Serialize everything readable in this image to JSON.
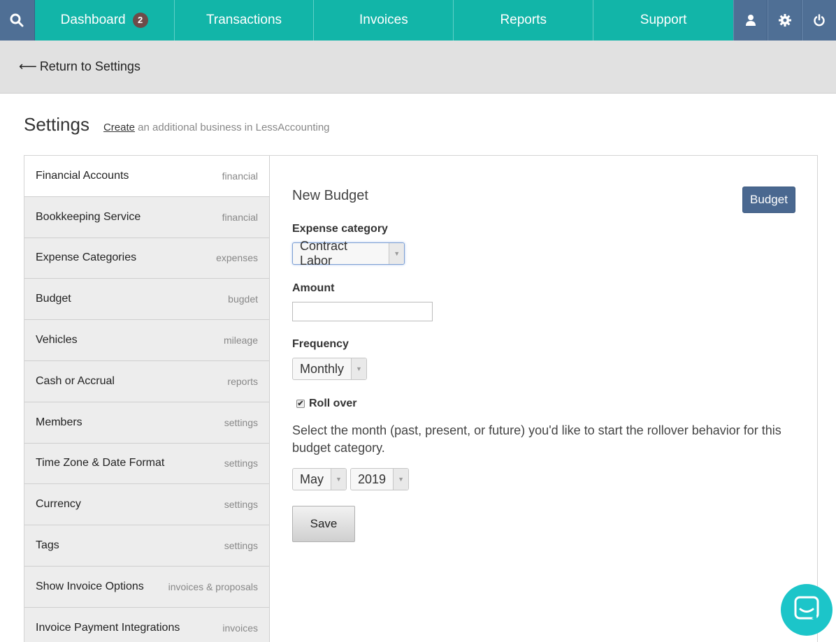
{
  "nav": {
    "search_icon": "search-icon",
    "items": [
      {
        "label": "Dashboard",
        "badge": "2"
      },
      {
        "label": "Transactions"
      },
      {
        "label": "Invoices"
      },
      {
        "label": "Reports"
      },
      {
        "label": "Support"
      }
    ],
    "right_icons": [
      "user-icon",
      "gear-icon",
      "power-icon"
    ]
  },
  "returnbar": {
    "arrow": "⟵",
    "label": "Return to Settings"
  },
  "settings": {
    "title": "Settings",
    "create_link": "Create",
    "subtitle_rest": " an additional business in LessAccounting"
  },
  "sidebar": {
    "items": [
      {
        "label": "Financial Accounts",
        "tag": "financial"
      },
      {
        "label": "Bookkeeping Service",
        "tag": "financial"
      },
      {
        "label": "Expense Categories",
        "tag": "expenses"
      },
      {
        "label": "Budget",
        "tag": "bugdet"
      },
      {
        "label": "Vehicles",
        "tag": "mileage"
      },
      {
        "label": "Cash or Accrual",
        "tag": "reports"
      },
      {
        "label": "Members",
        "tag": "settings"
      },
      {
        "label": "Time Zone & Date Format",
        "tag": "settings"
      },
      {
        "label": "Currency",
        "tag": "settings"
      },
      {
        "label": "Tags",
        "tag": "settings"
      },
      {
        "label": "Show Invoice Options",
        "tag": "invoices & proposals"
      },
      {
        "label": "Invoice Payment Integrations",
        "tag": "invoices"
      }
    ]
  },
  "form": {
    "title": "New Budget",
    "budget_button": "Budget",
    "expense_label": "Expense category",
    "expense_value": "Contract Labor",
    "amount_label": "Amount",
    "amount_value": "",
    "frequency_label": "Frequency",
    "frequency_value": "Monthly",
    "rollover_label": "Roll over",
    "rollover_checked": true,
    "description": "Select the month (past, present, or future) you'd like to start the rollover behavior for this budget category.",
    "month_value": "May",
    "year_value": "2019",
    "save_button": "Save"
  },
  "colors": {
    "nav_teal": "#12b5a8",
    "nav_icon_blue": "#4f6f95",
    "budget_button": "#4a6890",
    "chat_bubble": "#1cc5c9"
  }
}
